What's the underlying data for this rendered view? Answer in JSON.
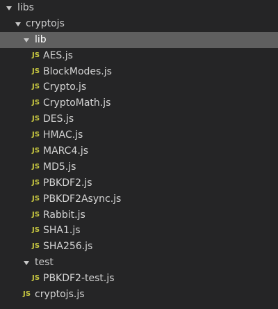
{
  "explorer": {
    "libs": {
      "label": "libs",
      "icon": "chevron-down-icon"
    },
    "cryptojs": {
      "label": "cryptojs",
      "icon": "chevron-down-icon"
    },
    "lib": {
      "label": "lib",
      "icon": "chevron-down-icon"
    },
    "file_badge": "JS",
    "lib_files": [
      "AES.js",
      "BlockModes.js",
      "Crypto.js",
      "CryptoMath.js",
      "DES.js",
      "HMAC.js",
      "MARC4.js",
      "MD5.js",
      "PBKDF2.js",
      "PBKDF2Async.js",
      "Rabbit.js",
      "SHA1.js",
      "SHA256.js"
    ],
    "test": {
      "label": "test",
      "icon": "chevron-down-icon"
    },
    "test_files": [
      "PBKDF2-test.js"
    ],
    "root_files": [
      "cryptojs.js"
    ],
    "colors": {
      "background": "#252526",
      "selected_row": "#5f5f5f",
      "js_badge": "#cbcb41",
      "text": "#cccccc"
    }
  }
}
